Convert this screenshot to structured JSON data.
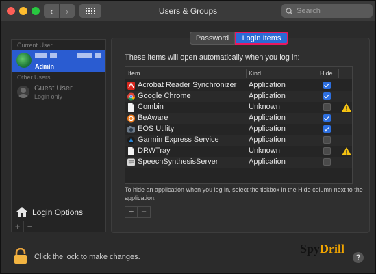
{
  "window": {
    "title": "Users & Groups"
  },
  "search": {
    "placeholder": "Search"
  },
  "sidebar": {
    "current_user_label": "Current User",
    "current_user": {
      "role": "Admin"
    },
    "other_users_label": "Other Users",
    "guest": {
      "name": "Guest User",
      "sub": "Login only"
    },
    "login_options": "Login Options",
    "add": "+",
    "remove": "−"
  },
  "tabs": [
    {
      "label": "Password"
    },
    {
      "label": "Login Items"
    }
  ],
  "intro": "These items will open automatically when you log in:",
  "table": {
    "headers": {
      "item": "Item",
      "kind": "Kind",
      "hide": "Hide"
    },
    "rows": [
      {
        "name": "Acrobat Reader Synchronizer",
        "kind": "Application",
        "hide": true,
        "icon": "acrobat-icon",
        "warning": false
      },
      {
        "name": "Google Chrome",
        "kind": "Application",
        "hide": true,
        "icon": "chrome-icon",
        "warning": false
      },
      {
        "name": "Combin",
        "kind": "Unknown",
        "hide": false,
        "icon": "document-icon",
        "warning": true
      },
      {
        "name": "BeAware",
        "kind": "Application",
        "hide": true,
        "icon": "beaware-icon",
        "warning": false
      },
      {
        "name": "EOS Utility",
        "kind": "Application",
        "hide": true,
        "icon": "eos-icon",
        "warning": false
      },
      {
        "name": "Garmin Express Service",
        "kind": "Application",
        "hide": false,
        "icon": "garmin-icon",
        "warning": false
      },
      {
        "name": "DRWTray",
        "kind": "Unknown",
        "hide": false,
        "icon": "document-icon",
        "warning": true
      },
      {
        "name": "SpeechSynthesisServer",
        "kind": "Application",
        "hide": false,
        "icon": "speech-icon",
        "warning": false
      }
    ]
  },
  "note": "To hide an application when you log in, select the tickbox in the Hide column next to the application.",
  "bottom": {
    "lock_text": "Click the lock to make changes.",
    "help": "?"
  },
  "brand": {
    "part1": "Spy",
    "part2": "Drill"
  },
  "colors": {
    "accent": "#2a6bd6",
    "highlight": "#e8185f",
    "selection": "#2a5cd1"
  }
}
